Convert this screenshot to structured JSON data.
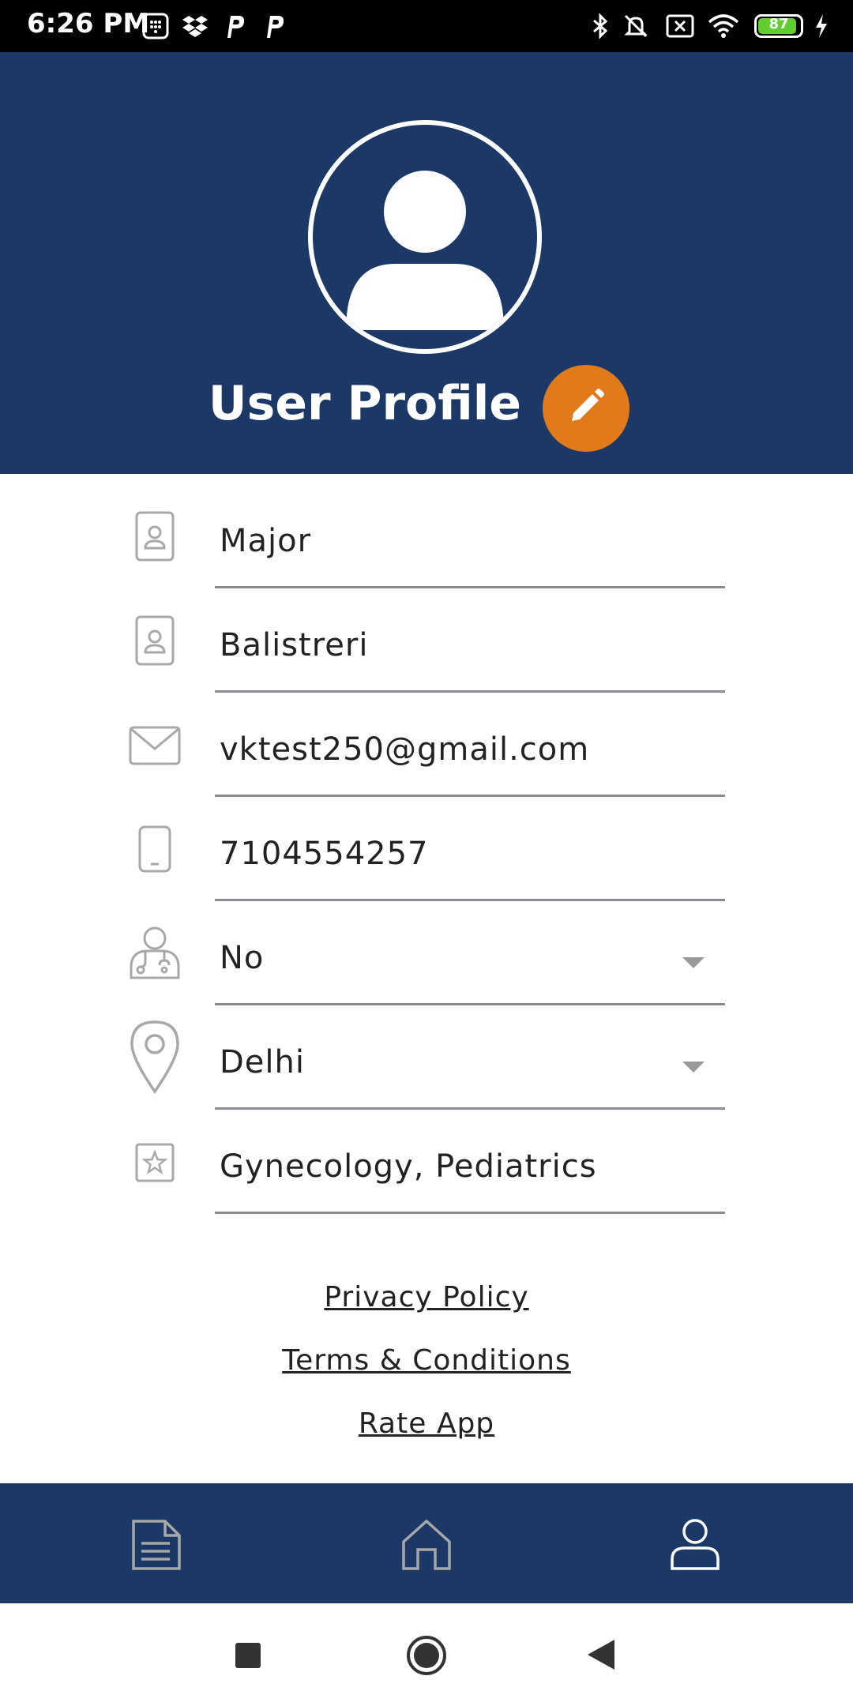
{
  "status_bar": {
    "time": "6:26 PM",
    "battery_level": "87",
    "icons": [
      "calculator-icon",
      "dropbox-icon",
      "p-app-icon",
      "p-app-icon",
      "bluetooth-icon",
      "bell-muted-icon",
      "close-box-icon",
      "wifi-icon",
      "battery-icon",
      "charging-icon"
    ]
  },
  "header": {
    "title": "User Profile",
    "avatar_icon": "user-avatar-icon",
    "edit_icon": "pencil-icon"
  },
  "form": {
    "first_name": "Major",
    "last_name": "Balistreri",
    "email": "vktest250@gmail.com",
    "phone": "7104554257",
    "doctor": "No",
    "city": "Delhi",
    "specialities": "Gynecology, Pediatrics"
  },
  "links": {
    "privacy": "Privacy Policy",
    "terms": "Terms & Conditions",
    "rate": "Rate App"
  },
  "bottom_nav": {
    "items": [
      "document-icon",
      "home-icon",
      "user-icon"
    ]
  },
  "colors": {
    "primary": "#1b3866",
    "accent": "#e07a1a",
    "icon_gray": "#a8a8a8"
  }
}
